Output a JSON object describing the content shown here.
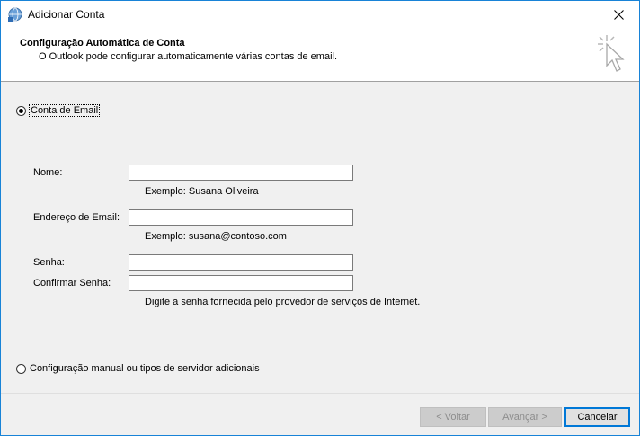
{
  "window": {
    "title": "Adicionar Conta",
    "close_icon": "close-icon",
    "app_icon": "globe-icon"
  },
  "header": {
    "title": "Configuração Automática de Conta",
    "subtitle": "O Outlook pode configurar automaticamente várias contas de email.",
    "icon": "cursor-sparkle-icon"
  },
  "email_account": {
    "label": "Conta de Email",
    "selected": true,
    "name_label": "Nome:",
    "name_value": "",
    "name_example": "Exemplo: Susana Oliveira",
    "email_label": "Endereço de Email:",
    "email_value": "",
    "email_example": "Exemplo: susana@contoso.com",
    "password_label": "Senha:",
    "password_value": "",
    "confirm_label": "Confirmar Senha:",
    "confirm_value": "",
    "password_hint": "Digite a senha fornecida pelo provedor de serviços de Internet."
  },
  "manual_setup": {
    "label": "Configuração manual ou tipos de servidor adicionais",
    "selected": false
  },
  "buttons": {
    "back": "< Voltar",
    "next": "Avançar >",
    "cancel": "Cancelar"
  }
}
